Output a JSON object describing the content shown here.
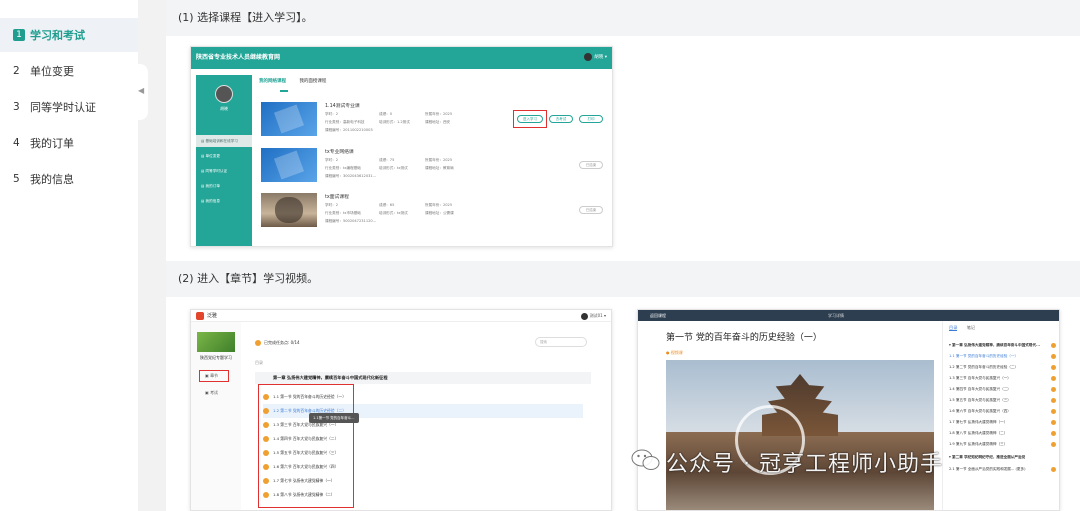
{
  "sidebar": {
    "items": [
      {
        "num": "1",
        "label": "学习和考试"
      },
      {
        "num": "2",
        "label": "单位变更"
      },
      {
        "num": "3",
        "label": "同等学时认证"
      },
      {
        "num": "4",
        "label": "我的订单"
      },
      {
        "num": "5",
        "label": "我的信息"
      }
    ],
    "collapse_glyph": "◀"
  },
  "steps": [
    {
      "text": "(1) 选择课程【进入学习】。"
    },
    {
      "text": "(2) 进入【章节】学习视频。"
    }
  ],
  "shot1": {
    "site_title": "陕西省专业技术人员继续教育网",
    "user": "胡晓 ▾",
    "profile_name": "胡晓",
    "menu": [
      "基础培训和在线学习",
      "单位变更",
      "同等学时认证",
      "我的订单",
      "我的信息"
    ],
    "tabs": [
      "我的网络课程",
      "我的面授课程"
    ],
    "courses": [
      {
        "title": "1.14测试专业课",
        "meta1": "学时：2",
        "meta2": "成绩：0",
        "meta3": "所属年份：2025",
        "meta4": "行业类别：高新电子科技",
        "meta5": "培训形式：1.2测试",
        "meta6": "课程地址：西安",
        "meta7": "课程编号：2011002210003",
        "buttons": [
          "进入学习",
          "去考试",
          "打印"
        ]
      },
      {
        "title": "tx专业网络课",
        "meta1": "学时：2",
        "meta2": "成绩：75",
        "meta3": "所属年份：2025",
        "meta4": "行业类别：tx编程基础",
        "meta5": "培训形式：tx测试",
        "meta6": "课程地址：教育局",
        "meta7": "课程编号：3002043612031...",
        "buttons": [
          "已结束"
        ]
      },
      {
        "title": "tx面试课程",
        "meta1": "学时：2",
        "meta2": "成绩：65",
        "meta3": "所属年份：2025",
        "meta4": "行业类别：tx市场基础",
        "meta5": "培训形式：tx测试",
        "meta6": "课程地址：公需课",
        "meta7": "课程编号：5002047231120...",
        "buttons": [
          "已结束"
        ]
      }
    ]
  },
  "shot2": {
    "app_name": "泛雅",
    "user": "测试01 ▾",
    "course_name": "陕西党纪专题学习",
    "nav": [
      "章节",
      "考试"
    ],
    "progress": "已完成任务点: 0/14",
    "search_placeholder": "搜索",
    "section_label": "目录",
    "chapter": "第一章  弘扬伟大建党精神，赓续百年奋斗中国式现代化新征程",
    "tooltip": "1.1第一节 党的百年奋斗...",
    "lessons": [
      "1.1 第一节  党的百年奋斗的历史经验（一）",
      "1.2 第二节  党的百年奋斗的历史经验（二）",
      "1.3 第三节  百年大党与民族复兴（一）",
      "1.4 第四节  百年大党与民族复兴（二）",
      "1.5 第五节  百年大党与民族复兴（三）",
      "1.6 第六节  百年大党与民族复兴（四）",
      "1.7 第七节  弘扬伟大建党精神（一）",
      "1.8 第八节  弘扬伟大建党精神（二）"
    ]
  },
  "shot3": {
    "back": "返回课程",
    "top_center": "学习详情",
    "title": "第一节    党的百年奋斗的历史经验（一）",
    "tag": "● 视频课",
    "tabs": [
      "目录",
      "笔记"
    ],
    "toc": [
      "▾ 第一章  弘扬伟大建党精神，赓续百年奋斗中国式现代...",
      "1.1 第一节  党的百年奋斗的历史经验（一）",
      "1.2 第二节  党的百年奋斗的历史经验（二）",
      "1.3 第三节  百年大党与民族复兴（一）",
      "1.4 第四节  百年大党与民族复兴（二）",
      "1.5 第五节  百年大党与民族复兴（三）",
      "1.6 第六节  百年大党与民族复兴（四）",
      "1.7 第七节  弘扬伟大建党精神（一）",
      "1.8 第八节  弘扬伟大建党精神（二）",
      "1.9 第九节  弘扬伟大建党精神（三）",
      "▾ 第二章  学纪知纪明纪守纪，推进全面从严治党",
      "2.1 第一节  全面从严治党的实践和发展...  (更多)"
    ]
  },
  "watermark": {
    "text": "公众号 · 冠亨工程师小助手"
  },
  "colors": {
    "accent": "#1f9e8f",
    "highlight": "#e03030",
    "panel_bg": "#f3f4f6"
  }
}
